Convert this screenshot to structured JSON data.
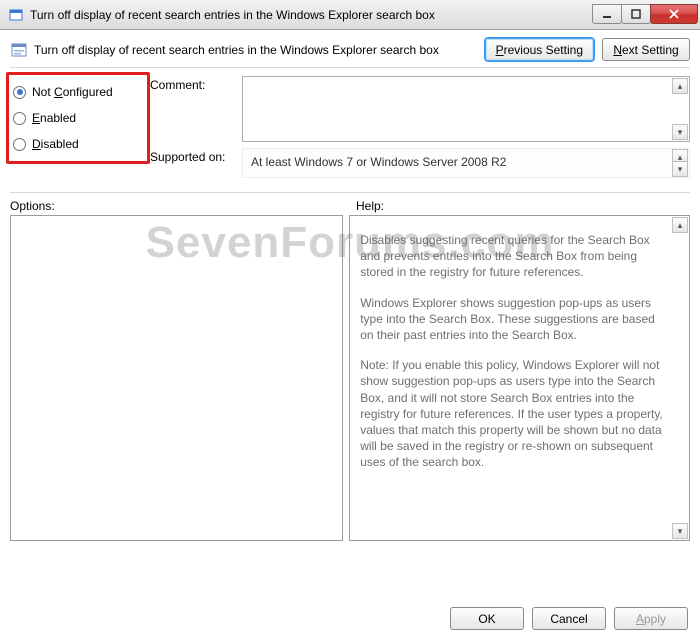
{
  "window": {
    "title": "Turn off display of recent search entries in the Windows Explorer search box"
  },
  "header": {
    "title": "Turn off display of recent search entries in the Windows Explorer search box",
    "prev_btn": "Previous Setting",
    "next_btn": "Next Setting"
  },
  "radios": {
    "not_configured": "Not Configured",
    "enabled": "Enabled",
    "disabled": "Disabled",
    "selected": "not_configured"
  },
  "fields": {
    "comment_label": "Comment:",
    "comment_value": "",
    "supported_label": "Supported on:",
    "supported_value": "At least Windows 7 or Windows Server 2008 R2"
  },
  "panes": {
    "options_label": "Options:",
    "help_label": "Help:",
    "help_p1": "Disables suggesting recent queries for the Search Box and prevents entries into the Search Box from being stored in the registry for future references.",
    "help_p2": "Windows Explorer shows suggestion pop-ups as users type into the Search Box.  These suggestions are based on their past entries into the Search Box.",
    "help_p3": "Note: If you enable this policy, Windows Explorer will not show suggestion pop-ups as users type into the Search Box, and it will not store Search Box entries into the registry for future references.  If the user types a property, values that match this property will be shown but no data will be saved in the registry or re-shown on subsequent uses of the search box."
  },
  "buttons": {
    "ok": "OK",
    "cancel": "Cancel",
    "apply": "Apply"
  },
  "watermark": "SevenForums.com"
}
